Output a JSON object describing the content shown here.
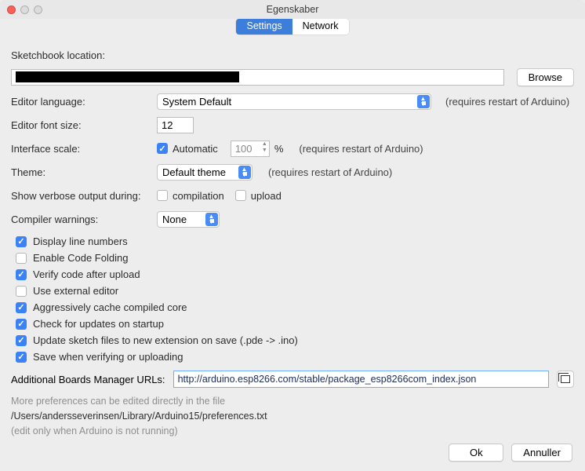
{
  "window": {
    "title": "Egenskaber"
  },
  "tabs": {
    "settings": "Settings",
    "network": "Network"
  },
  "sketchbook": {
    "label": "Sketchbook location:",
    "browse": "Browse"
  },
  "language": {
    "label": "Editor language:",
    "value": "System Default",
    "hint": "(requires restart of Arduino)"
  },
  "fontsize": {
    "label": "Editor font size:",
    "value": "12"
  },
  "scale": {
    "label": "Interface scale:",
    "auto_label": "Automatic",
    "value": "100",
    "unit": "%",
    "hint": "(requires restart of Arduino)"
  },
  "theme": {
    "label": "Theme:",
    "value": "Default theme",
    "hint": "(requires restart of Arduino)"
  },
  "verbose": {
    "label": "Show verbose output during:",
    "compilation": "compilation",
    "upload": "upload"
  },
  "warnings": {
    "label": "Compiler warnings:",
    "value": "None"
  },
  "options": {
    "line_numbers": "Display line numbers",
    "code_folding": "Enable Code Folding",
    "verify_upload": "Verify code after upload",
    "external_editor": "Use external editor",
    "cache_core": "Aggressively cache compiled core",
    "check_updates": "Check for updates on startup",
    "update_ext": "Update sketch files to new extension on save (.pde -> .ino)",
    "save_verify": "Save when verifying or uploading"
  },
  "boards": {
    "label": "Additional Boards Manager URLs:",
    "value": "http://arduino.esp8266.com/stable/package_esp8266com_index.json"
  },
  "footer_note": {
    "line1": "More preferences can be edited directly in the file",
    "line2": "/Users/andersseverinsen/Library/Arduino15/preferences.txt",
    "line3": "(edit only when Arduino is not running)"
  },
  "buttons": {
    "ok": "Ok",
    "cancel": "Annuller"
  }
}
